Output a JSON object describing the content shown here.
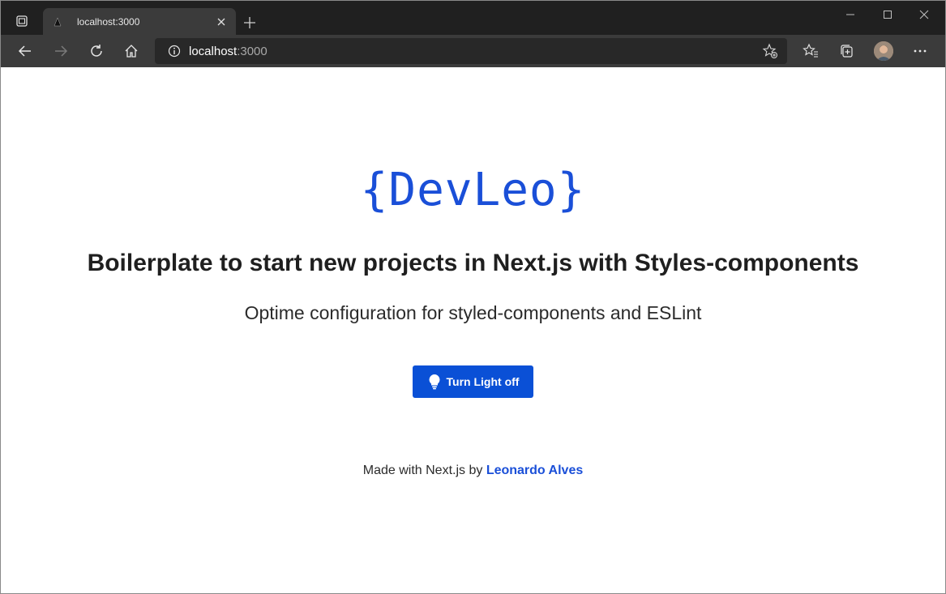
{
  "browser": {
    "tab": {
      "title": "localhost:3000"
    },
    "address": {
      "host": "localhost",
      "port": ":3000"
    }
  },
  "page": {
    "logo_text": "{DevLeo}",
    "headline": "Boilerplate to start new projects in Next.js with Styles-components",
    "subtitle": "Optime configuration for styled-components and ESLint",
    "button_label": "Turn Light off",
    "footer_prefix": "Made with Next.js by ",
    "footer_author": "Leonardo Alves"
  },
  "colors": {
    "accent": "#0a50d6",
    "logo": "#1a4fd8",
    "browser_dark": "#202020",
    "toolbar": "#3b3b3b"
  }
}
